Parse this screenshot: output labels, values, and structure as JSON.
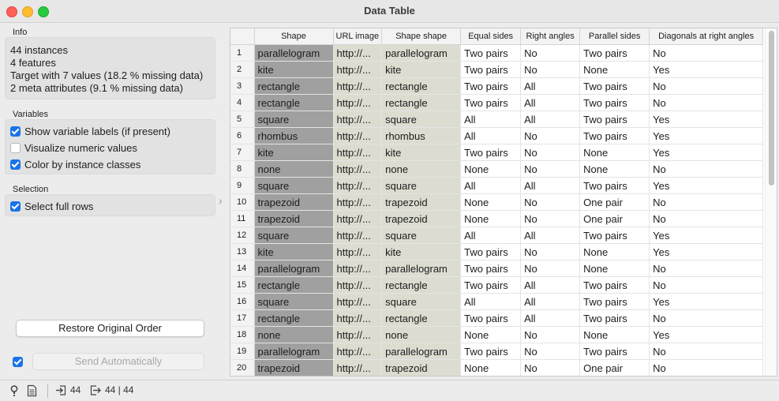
{
  "window": {
    "title": "Data Table"
  },
  "info": {
    "label": "Info",
    "lines": [
      "44 instances",
      "4 features",
      "Target with 7 values (18.2 % missing data)",
      "2 meta attributes (9.1 % missing data)"
    ]
  },
  "variables": {
    "label": "Variables",
    "options": [
      {
        "label": "Show variable labels (if present)",
        "checked": true
      },
      {
        "label": "Visualize numeric values",
        "checked": false
      },
      {
        "label": "Color by instance classes",
        "checked": true
      }
    ]
  },
  "selection": {
    "label": "Selection",
    "options": [
      {
        "label": "Select full rows",
        "checked": true
      }
    ]
  },
  "buttons": {
    "restore": "Restore Original Order",
    "send": "Send Automatically",
    "send_auto_checked": true
  },
  "table": {
    "columns": [
      "Shape",
      "URL image",
      "Shape shape",
      "Equal sides",
      "Right angles",
      "Parallel sides",
      "Diagonals at right angles"
    ],
    "rows": [
      [
        "1",
        "parallelogram",
        "http://...",
        "parallelogram",
        "Two pairs",
        "No",
        "Two pairs",
        "No"
      ],
      [
        "2",
        "kite",
        "http://...",
        "kite",
        "Two pairs",
        "No",
        "None",
        "Yes"
      ],
      [
        "3",
        "rectangle",
        "http://...",
        "rectangle",
        "Two pairs",
        "All",
        "Two pairs",
        "No"
      ],
      [
        "4",
        "rectangle",
        "http://...",
        "rectangle",
        "Two pairs",
        "All",
        "Two pairs",
        "No"
      ],
      [
        "5",
        "square",
        "http://...",
        "square",
        "All",
        "All",
        "Two pairs",
        "Yes"
      ],
      [
        "6",
        "rhombus",
        "http://...",
        "rhombus",
        "All",
        "No",
        "Two pairs",
        "Yes"
      ],
      [
        "7",
        "kite",
        "http://...",
        "kite",
        "Two pairs",
        "No",
        "None",
        "Yes"
      ],
      [
        "8",
        "none",
        "http://...",
        "none",
        "None",
        "No",
        "None",
        "No"
      ],
      [
        "9",
        "square",
        "http://...",
        "square",
        "All",
        "All",
        "Two pairs",
        "Yes"
      ],
      [
        "10",
        "trapezoid",
        "http://...",
        "trapezoid",
        "None",
        "No",
        "One pair",
        "No"
      ],
      [
        "11",
        "trapezoid",
        "http://...",
        "trapezoid",
        "None",
        "No",
        "One pair",
        "No"
      ],
      [
        "12",
        "square",
        "http://...",
        "square",
        "All",
        "All",
        "Two pairs",
        "Yes"
      ],
      [
        "13",
        "kite",
        "http://...",
        "kite",
        "Two pairs",
        "No",
        "None",
        "Yes"
      ],
      [
        "14",
        "parallelogram",
        "http://...",
        "parallelogram",
        "Two pairs",
        "No",
        "None",
        "No"
      ],
      [
        "15",
        "rectangle",
        "http://...",
        "rectangle",
        "Two pairs",
        "All",
        "Two pairs",
        "No"
      ],
      [
        "16",
        "square",
        "http://...",
        "square",
        "All",
        "All",
        "Two pairs",
        "Yes"
      ],
      [
        "17",
        "rectangle",
        "http://...",
        "rectangle",
        "Two pairs",
        "All",
        "Two pairs",
        "No"
      ],
      [
        "18",
        "none",
        "http://...",
        "none",
        "None",
        "No",
        "None",
        "Yes"
      ],
      [
        "19",
        "parallelogram",
        "http://...",
        "parallelogram",
        "Two pairs",
        "No",
        "Two pairs",
        "No"
      ],
      [
        "20",
        "trapezoid",
        "http://...",
        "trapezoid",
        "None",
        "No",
        "One pair",
        "No"
      ]
    ]
  },
  "status": {
    "input_count": "44",
    "output_count": "44 | 44"
  }
}
